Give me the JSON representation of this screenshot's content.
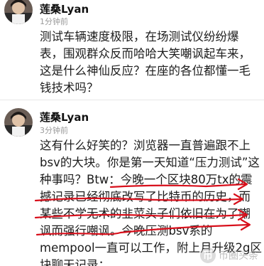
{
  "colors": {
    "annotation": "#d8101c",
    "text": "#1c1c1c",
    "meta": "#9a9a9a"
  },
  "posts": [
    {
      "username": "莲桑Lyan",
      "time": "1分钟前",
      "lines": [
        "测试车辆速度极限，在场测试仪纷纷爆",
        "表，围观群众反而哈哈大笑嘲讽起车来，",
        "这是什么神仙反应？在座的各位都懂一毛",
        "钱技术吗？"
      ]
    },
    {
      "username": "莲桑Lyan",
      "time": "3分钟前",
      "lines": [
        "这有什么好笑的？浏览器一直普遍跟不上",
        "bsv的大块。你是第一天知道“压力测试”这",
        "种事吗？Btw：今晚一个区块80万tx的震",
        "撼记录已经彻底改写了比特币的历史，而",
        "某些不学无术的韭菜头子们依旧在为了嘲",
        "讽而强行嘲讽。今晚压测bsv系的",
        "mempool一直可以工作，附上月升级2g区",
        "块聊天记录："
      ]
    }
  ],
  "watermark": {
    "badge": "币",
    "text": "币圈头条"
  }
}
